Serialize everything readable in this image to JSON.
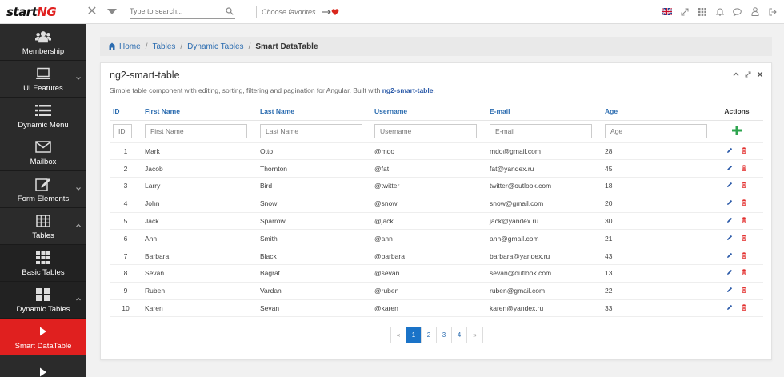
{
  "app": {
    "logo_prefix": "start",
    "logo_suffix": "NG"
  },
  "topbar": {
    "search_placeholder": "Type to search...",
    "favorites_label": "Choose favorites"
  },
  "sidebar": {
    "items": [
      {
        "label": "Membership",
        "icon": "users-icon"
      },
      {
        "label": "UI Features",
        "icon": "laptop-icon"
      },
      {
        "label": "Dynamic Menu",
        "icon": "list-icon"
      },
      {
        "label": "Mailbox",
        "icon": "envelope-icon"
      },
      {
        "label": "Form Elements",
        "icon": "edit-icon"
      },
      {
        "label": "Tables",
        "icon": "table-icon"
      },
      {
        "label": "Basic Tables",
        "icon": "grid-icon"
      },
      {
        "label": "Dynamic Tables",
        "icon": "grid-large-icon"
      },
      {
        "label": "Smart DataTable",
        "icon": "play-icon"
      }
    ]
  },
  "breadcrumb": {
    "home": "Home",
    "tables": "Tables",
    "dynamic": "Dynamic Tables",
    "current": "Smart DataTable"
  },
  "panel": {
    "title": "ng2-smart-table",
    "desc_prefix": "Simple table component with editing, sorting, filtering and pagination for Angular. Built with",
    "desc_link": "ng2-smart-table",
    "desc_suffix": "."
  },
  "table": {
    "headers": {
      "id": "ID",
      "first": "First Name",
      "last": "Last Name",
      "user": "Username",
      "email": "E-mail",
      "age": "Age",
      "actions": "Actions"
    },
    "filters": {
      "id": "ID",
      "first": "First Name",
      "last": "Last Name",
      "user": "Username",
      "email": "E-mail",
      "age": "Age"
    },
    "rows": [
      [
        "1",
        "Mark",
        "Otto",
        "@mdo",
        "mdo@gmail.com",
        "28"
      ],
      [
        "2",
        "Jacob",
        "Thornton",
        "@fat",
        "fat@yandex.ru",
        "45"
      ],
      [
        "3",
        "Larry",
        "Bird",
        "@twitter",
        "twitter@outlook.com",
        "18"
      ],
      [
        "4",
        "John",
        "Snow",
        "@snow",
        "snow@gmail.com",
        "20"
      ],
      [
        "5",
        "Jack",
        "Sparrow",
        "@jack",
        "jack@yandex.ru",
        "30"
      ],
      [
        "6",
        "Ann",
        "Smith",
        "@ann",
        "ann@gmail.com",
        "21"
      ],
      [
        "7",
        "Barbara",
        "Black",
        "@barbara",
        "barbara@yandex.ru",
        "43"
      ],
      [
        "8",
        "Sevan",
        "Bagrat",
        "@sevan",
        "sevan@outlook.com",
        "13"
      ],
      [
        "9",
        "Ruben",
        "Vardan",
        "@ruben",
        "ruben@gmail.com",
        "22"
      ],
      [
        "10",
        "Karen",
        "Sevan",
        "@karen",
        "karen@yandex.ru",
        "33"
      ]
    ]
  },
  "pager": {
    "prev": "«",
    "pages": [
      "1",
      "2",
      "3",
      "4"
    ],
    "next": "»",
    "active": "1"
  },
  "colors": {
    "accent": "#e0201f",
    "link": "#2b6cb0",
    "add": "#2ea44f"
  }
}
